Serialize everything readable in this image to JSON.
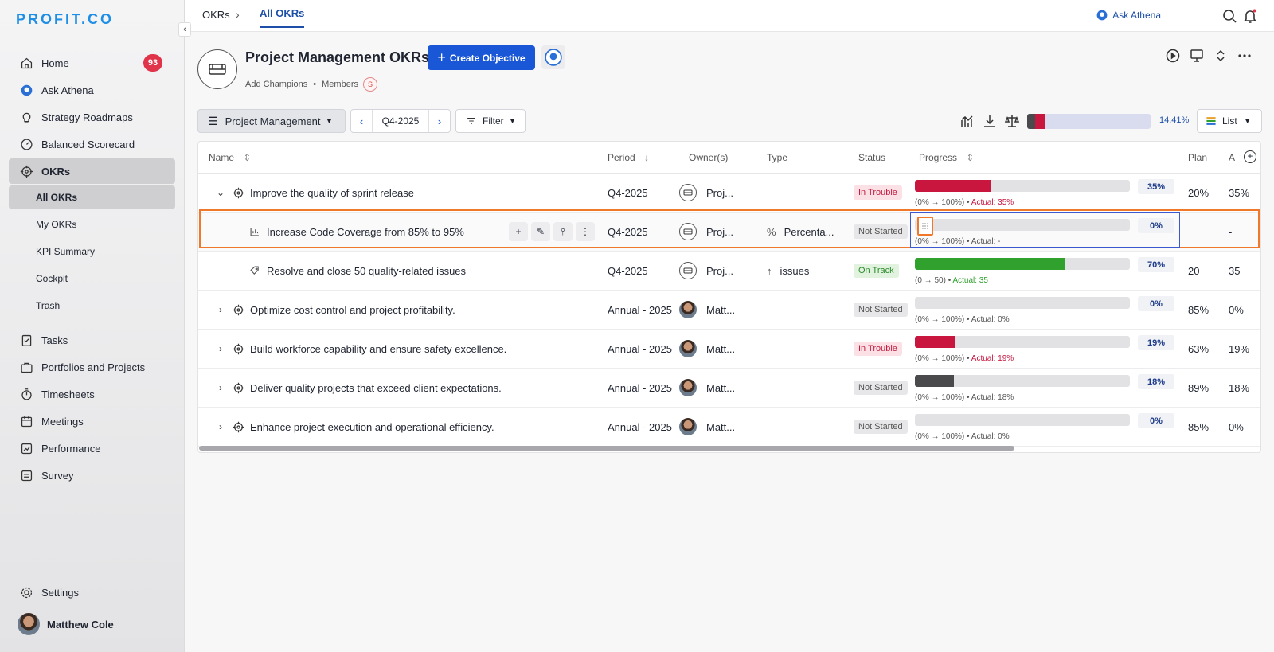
{
  "brand": {
    "logo": "PROFIT.CO"
  },
  "sidebar": {
    "items": [
      {
        "label": "Home",
        "badge": "93"
      },
      {
        "label": "Ask Athena"
      },
      {
        "label": "Strategy Roadmaps"
      },
      {
        "label": "Balanced Scorecard"
      },
      {
        "label": "OKRs"
      },
      {
        "label": "Tasks"
      },
      {
        "label": "Portfolios and Projects"
      },
      {
        "label": "Timesheets"
      },
      {
        "label": "Meetings"
      },
      {
        "label": "Performance"
      },
      {
        "label": "Survey"
      }
    ],
    "sub_items": [
      "All OKRs",
      "My OKRs",
      "KPI Summary",
      "Cockpit",
      "Trash"
    ],
    "settings": "Settings",
    "user": "Matthew Cole"
  },
  "topbar": {
    "crumb": "OKRs",
    "crumb_sep": "›",
    "active_tab": "All OKRs",
    "ask_athena": "Ask Athena"
  },
  "header": {
    "title": "Project Management OKRs",
    "create_button": "Create Objective",
    "add_champions": "Add Champions",
    "members": "Members",
    "members_badge": "S"
  },
  "toolbar": {
    "group_select": "Project Management",
    "period": "Q4-2025",
    "filter": "Filter",
    "overall_progress": "14.41%",
    "view": "List"
  },
  "table": {
    "columns": [
      "Name",
      "Period",
      "Owner(s)",
      "Type",
      "Status",
      "Progress",
      "Plan",
      "A"
    ],
    "rows": [
      {
        "name": "Improve the quality of sprint release",
        "period": "Q4-2025",
        "owner": "Proj...",
        "type": "",
        "status": "In Trouble",
        "progress": "35%",
        "progress_fraction": 0.35,
        "range": "(0%",
        "range_to": "100%)",
        "actual": "Actual: 35%",
        "plan": "20%",
        "a": "35%"
      },
      {
        "name": "Increase Code Coverage from 85% to 95%",
        "period": "Q4-2025",
        "owner": "Proj...",
        "type": "Percenta...",
        "status": "Not Started",
        "progress": "0%",
        "progress_fraction": 0,
        "range": "(0%",
        "range_to": "100%)",
        "actual": "Actual: -",
        "plan": "",
        "a": "-"
      },
      {
        "name": "Resolve and close 50 quality-related issues",
        "period": "Q4-2025",
        "owner": "Proj...",
        "type": "issues",
        "status": "On Track",
        "progress": "70%",
        "progress_fraction": 0.7,
        "range": "(0",
        "range_to": "50)",
        "actual": "Actual: 35",
        "plan": "20",
        "a": "35"
      },
      {
        "name": "Optimize cost control and project profitability.",
        "period": "Annual - 2025",
        "owner": "Matt...",
        "type": "",
        "status": "Not Started",
        "progress": "0%",
        "progress_fraction": 0,
        "range": "(0%",
        "range_to": "100%)",
        "actual": "Actual: 0%",
        "plan": "85%",
        "a": "0%"
      },
      {
        "name": "Build workforce capability and ensure safety excellence.",
        "period": "Annual - 2025",
        "owner": "Matt...",
        "type": "",
        "status": "In Trouble",
        "progress": "19%",
        "progress_fraction": 0.19,
        "range": "(0%",
        "range_to": "100%)",
        "actual": "Actual: 19%",
        "plan": "63%",
        "a": "19%"
      },
      {
        "name": "Deliver quality projects that exceed client expectations.",
        "period": "Annual - 2025",
        "owner": "Matt...",
        "type": "",
        "status": "Not Started",
        "progress": "18%",
        "progress_fraction": 0.18,
        "range": "(0%",
        "range_to": "100%)",
        "actual": "Actual: 18%",
        "plan": "89%",
        "a": "18%"
      },
      {
        "name": "Enhance project execution and operational efficiency.",
        "period": "Annual - 2025",
        "owner": "Matt...",
        "type": "",
        "status": "Not Started",
        "progress": "0%",
        "progress_fraction": 0,
        "range": "(0%",
        "range_to": "100%)",
        "actual": "Actual: 0%",
        "plan": "85%",
        "a": "0%"
      }
    ]
  },
  "colors": {
    "accent": "#1a57d6",
    "trouble": "#c8163f",
    "on_track": "#2fa12c",
    "not_started": "#4a4a4c"
  }
}
